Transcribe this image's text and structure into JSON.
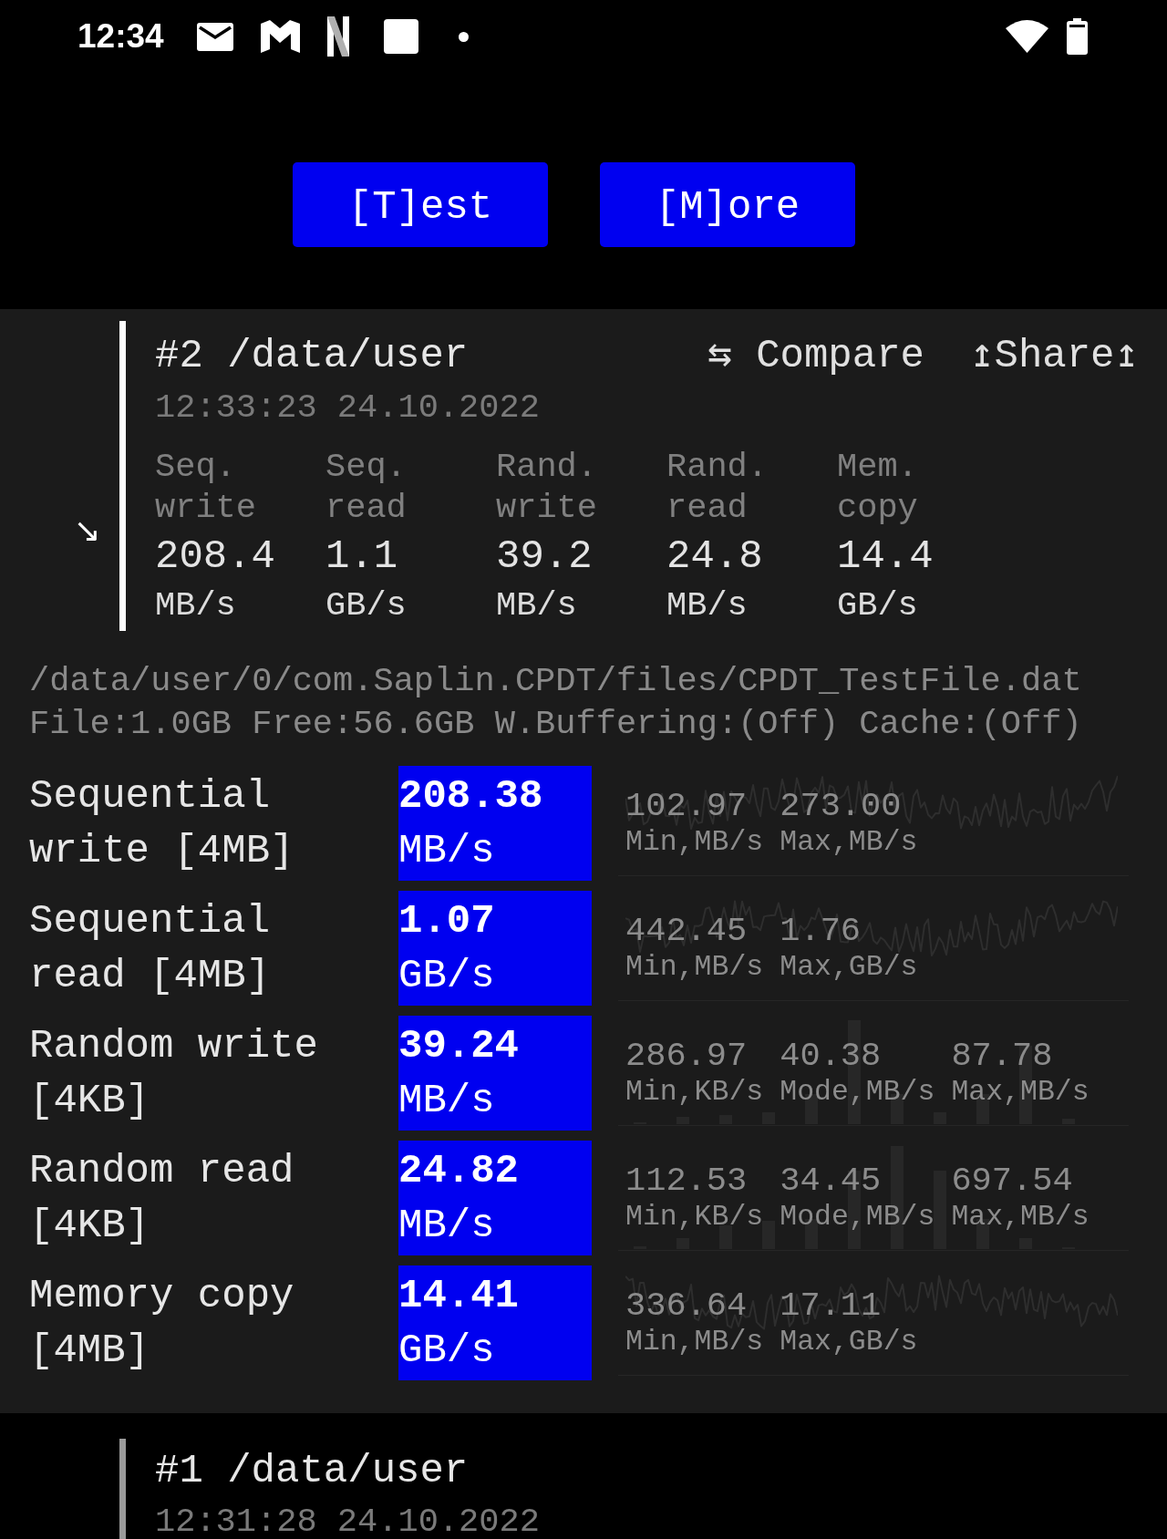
{
  "status_bar": {
    "time": "12:34"
  },
  "toolbar": {
    "buttons": [
      {
        "label": "[T]est"
      },
      {
        "label": "[M]ore"
      }
    ]
  },
  "results": [
    {
      "selected": true,
      "toggle": "↘",
      "title": "#2 /data/user",
      "timestamp": "12:33:23 24.10.2022",
      "actions": [
        {
          "label": "⇆ Compare"
        },
        {
          "label": "↥Share↥"
        }
      ],
      "summary": [
        {
          "label": "Seq. write",
          "value": "208.4",
          "unit": "MB/s"
        },
        {
          "label": "Seq. read",
          "value": "1.1",
          "unit": "GB/s"
        },
        {
          "label": "Rand. write",
          "value": "39.2",
          "unit": "MB/s"
        },
        {
          "label": "Rand. read",
          "value": "24.8",
          "unit": "MB/s"
        },
        {
          "label": "Mem. copy",
          "value": "14.4",
          "unit": "GB/s"
        }
      ],
      "details": {
        "path": "/data/user/0/com.Saplin.CPDT/files/CPDT_TestFile.dat",
        "info": "File:1.0GB Free:56.6GB W.Buffering:(Off) Cache:(Off)",
        "tests": [
          {
            "kind": "line",
            "name": "Sequential write [4MB]",
            "value": "208.38",
            "unit": "MB/s",
            "stats": [
              {
                "value": "102.97",
                "label": "Min,MB/s"
              },
              {
                "value": "273.00",
                "label": "Max,MB/s"
              }
            ]
          },
          {
            "kind": "line",
            "name": "Sequential read [4MB]",
            "value": "1.07",
            "unit": "GB/s",
            "stats": [
              {
                "value": "442.45",
                "label": "Min,MB/s"
              },
              {
                "value": "1.76",
                "label": "Max,GB/s"
              }
            ]
          },
          {
            "kind": "histogram",
            "name": "Random write [4KB]",
            "value": "39.24",
            "unit": "MB/s",
            "stats": [
              {
                "value": "286.97",
                "label": "Min,KB/s"
              },
              {
                "value": "40.38",
                "label": "Mode,MB/s"
              },
              {
                "value": "87.78",
                "label": "Max,MB/s"
              }
            ]
          },
          {
            "kind": "histogram",
            "name": "Random read [4KB]",
            "value": "24.82",
            "unit": "MB/s",
            "stats": [
              {
                "value": "112.53",
                "label": "Min,KB/s"
              },
              {
                "value": "34.45",
                "label": "Mode,MB/s"
              },
              {
                "value": "697.54",
                "label": "Max,MB/s"
              }
            ]
          },
          {
            "kind": "line",
            "name": "Memory copy [4MB]",
            "value": "14.41",
            "unit": "GB/s",
            "stats": [
              {
                "value": "336.64",
                "label": "Min,MB/s"
              },
              {
                "value": "17.11",
                "label": "Max,GB/s"
              }
            ]
          }
        ]
      }
    },
    {
      "selected": false,
      "title": "#1 /data/user",
      "timestamp": "12:31:28 24.10.2022"
    }
  ]
}
